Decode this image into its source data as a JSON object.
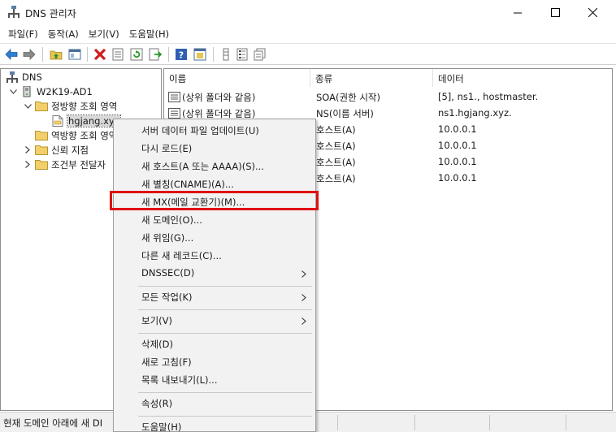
{
  "window": {
    "title": "DNS 관리자"
  },
  "menubar": [
    "파일(F)",
    "동작(A)",
    "보기(V)",
    "도움말(H)"
  ],
  "toolbar": {
    "icons": [
      "back-arrow-icon",
      "forward-arrow-icon",
      "folder-up-icon",
      "show-hide-tree-icon",
      "delete-icon",
      "properties-icon",
      "refresh-icon",
      "export-list-icon",
      "help-icon",
      "help-topic-icon",
      "column-icon",
      "list-icon",
      "copy-icon"
    ]
  },
  "tree": {
    "root": "DNS",
    "server": "W2K19-AD1",
    "forward_zone": "정방향 조회 영역",
    "zone": "hgjang.xyz",
    "reverse_zone": "역방향 조회 영역",
    "trust_points": "신뢰 지점",
    "conditional_forwarders": "조건부 전달자"
  },
  "list": {
    "columns": [
      "이름",
      "종류",
      "데이터"
    ],
    "rows": [
      {
        "name": "(상위 폴더와 같음)",
        "type": "SOA(권한 시작)",
        "data": "[5], ns1., hostmaster."
      },
      {
        "name": "(상위 폴더와 같음)",
        "type": "NS(이름 서버)",
        "data": "ns1.hgjang.xyz."
      },
      {
        "name": "",
        "type": "호스트(A)",
        "data": "10.0.0.1"
      },
      {
        "name": "",
        "type": "호스트(A)",
        "data": "10.0.0.1"
      },
      {
        "name": "",
        "type": "호스트(A)",
        "data": "10.0.0.1"
      },
      {
        "name": "",
        "type": "호스트(A)",
        "data": "10.0.0.1"
      }
    ]
  },
  "status": {
    "text": "현재 도메인 아래에 새 DI"
  },
  "context_menu": {
    "items": [
      "서버 데이터 파일 업데이트(U)",
      "다시 로드(E)",
      "새 호스트(A 또는 AAAA)(S)...",
      "새 별칭(CNAME)(A)...",
      "새 MX(메일 교환기)(M)...",
      "새 도메인(O)...",
      "새 위임(G)...",
      "다른 새 레코드(C)...",
      "DNSSEC(D)",
      "모든 작업(K)",
      "보기(V)",
      "삭제(D)",
      "새로 고침(F)",
      "목록 내보내기(L)...",
      "속성(R)",
      "도움말(H)"
    ]
  },
  "colors": {
    "highlight": "#e01010",
    "menu_bg": "#f2f2f2"
  }
}
